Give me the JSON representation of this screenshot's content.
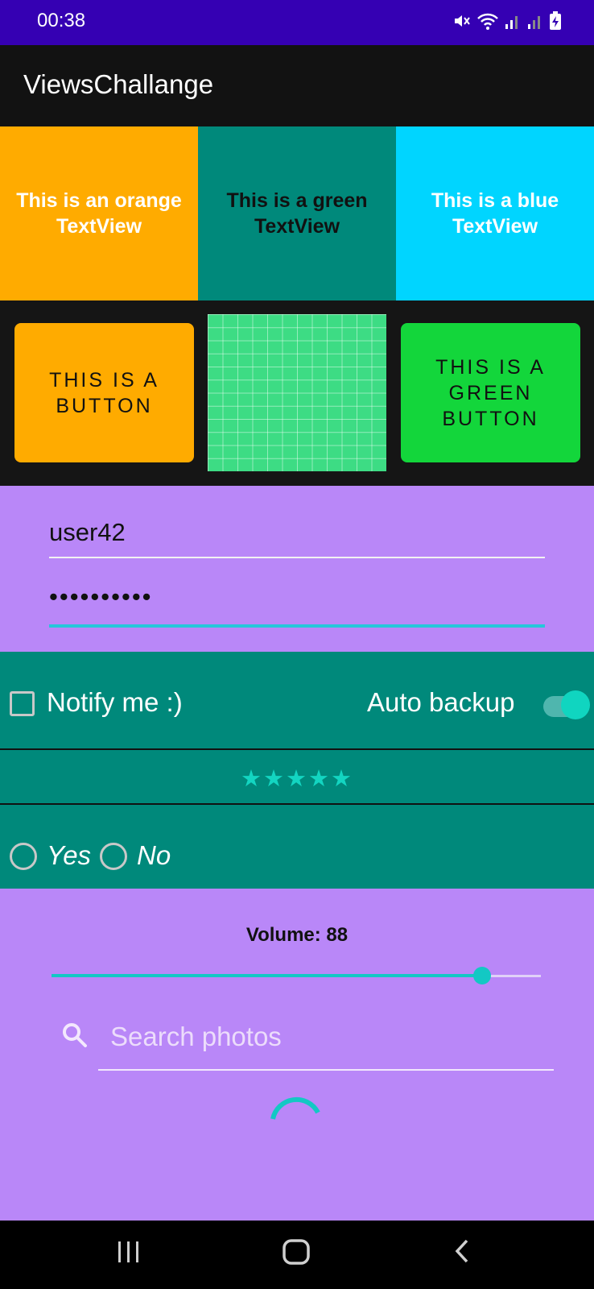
{
  "status_bar": {
    "time": "00:38",
    "icons": [
      "mute-icon",
      "wifi-icon",
      "signal-icon",
      "signal-icon",
      "battery-charging-icon"
    ]
  },
  "app_bar": {
    "title": "ViewsChallange"
  },
  "text_views": {
    "orange": "This is an orange TextView",
    "green": "This is a green TextView",
    "blue": "This is a blue TextView"
  },
  "buttons": {
    "orange": "THIS IS A BUTTON",
    "green": "THIS IS A GREEN BUTTON"
  },
  "form": {
    "username": "user42",
    "password": "••••••••••"
  },
  "options": {
    "checkbox_label": "Notify me :)",
    "checkbox_checked": false,
    "switch_label": "Auto backup",
    "switch_on": true,
    "rating_stars": "★★★★★",
    "rating_value": 5,
    "radio_yes": "Yes",
    "radio_no": "No"
  },
  "volume": {
    "label": "Volume: 88",
    "value": 88
  },
  "search": {
    "placeholder": "Search photos"
  },
  "colors": {
    "status_bar": "#3500b3",
    "app_bar": "#121212",
    "orange": "#ffab00",
    "teal": "#00897b",
    "blue": "#00d5ff",
    "green_button": "#13d63b",
    "purple": "#b987f8",
    "accent": "#13c8c4"
  }
}
